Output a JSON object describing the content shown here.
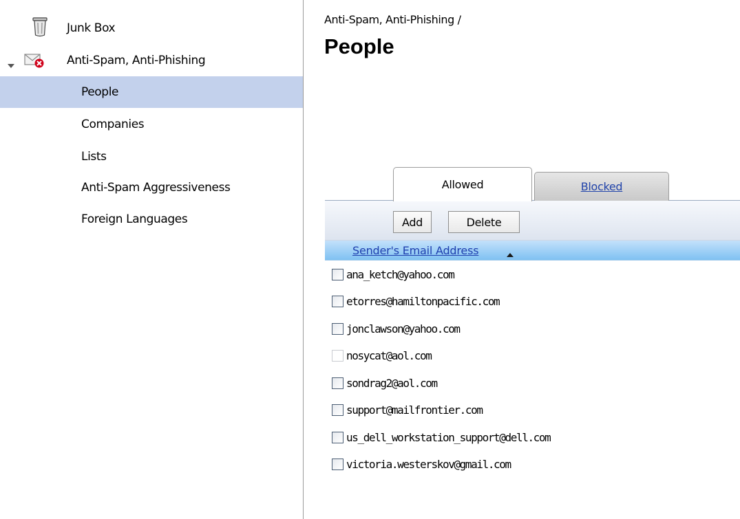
{
  "sidebar": {
    "items": [
      {
        "label": "Junk Box"
      },
      {
        "label": "Anti-Spam, Anti-Phishing"
      },
      {
        "label": "People"
      },
      {
        "label": "Companies"
      },
      {
        "label": "Lists"
      },
      {
        "label": "Anti-Spam Aggressiveness"
      },
      {
        "label": "Foreign Languages"
      }
    ],
    "selected_index": 2
  },
  "main": {
    "breadcrumb": "Anti-Spam, Anti-Phishing /",
    "title": "People",
    "tabs": [
      {
        "label": "Allowed",
        "active": true
      },
      {
        "label": "Blocked",
        "active": false
      }
    ],
    "toolbar": {
      "add_label": "Add",
      "delete_label": "Delete"
    },
    "table": {
      "column_header": "Sender's Email Address",
      "sort": "ascending",
      "rows": [
        "ana_ketch@yahoo.com",
        "etorres@hamiltonpacific.com",
        "jonclawson@yahoo.com",
        "nosycat@aol.com",
        "sondrag2@aol.com",
        "support@mailfrontier.com",
        "us_dell_workstation_support@dell.com",
        "victoria.westerskov@gmail.com"
      ]
    }
  },
  "colors": {
    "selected_row_bg": "#c3d1ec",
    "header_bg": "#7fc1f2",
    "link_color": "#1f3fae"
  }
}
